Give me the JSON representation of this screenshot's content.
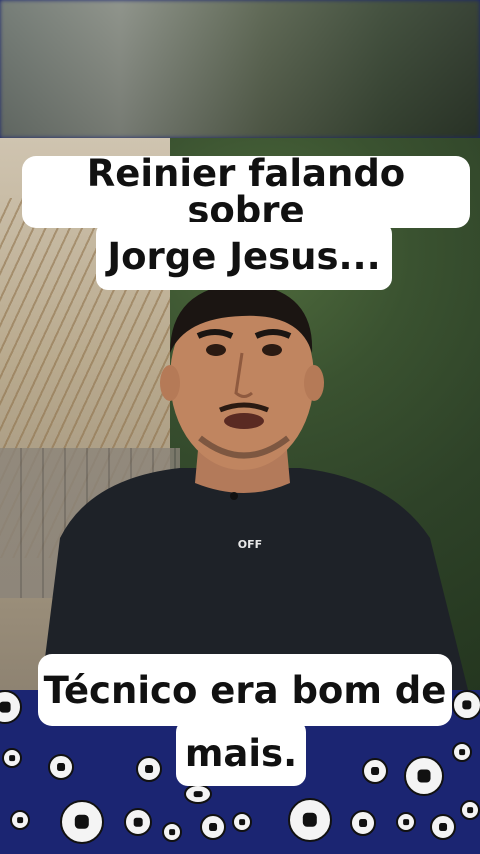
{
  "captions": {
    "top_line1": "Reinier falando sobre",
    "top_line2": "Jorge Jesus...",
    "bottom_line1": "Técnico era bom de",
    "bottom_line2": "mais."
  },
  "shirt_logo": "OFF",
  "colors": {
    "caption_bg": "#ffffff",
    "caption_text": "#111111",
    "ball_field": "#1b2572"
  }
}
